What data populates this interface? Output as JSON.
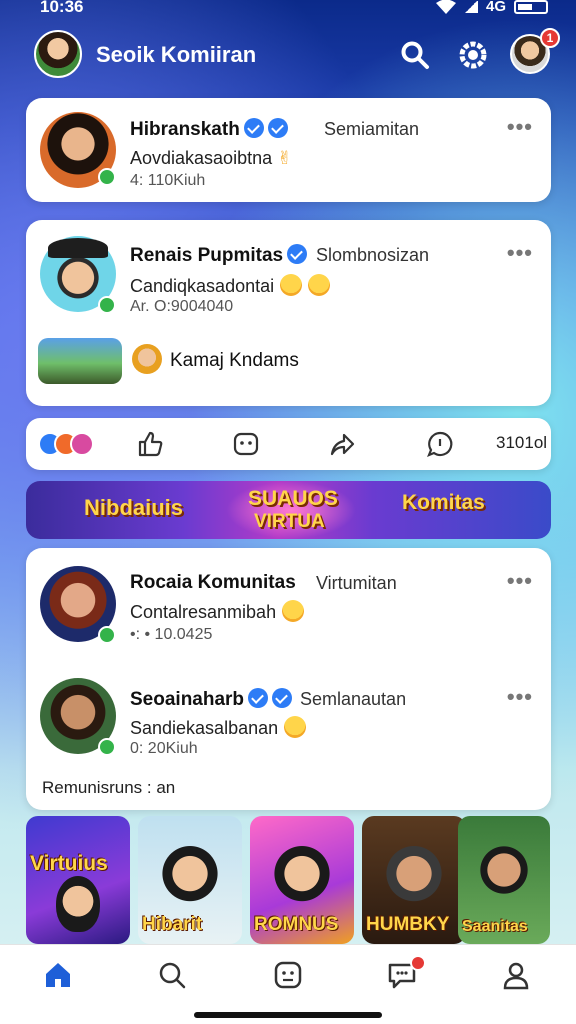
{
  "status_bar": {
    "time": "10:36",
    "network": "4G"
  },
  "header": {
    "title": "Seoik Komiiran",
    "notification_count": "1"
  },
  "posts": [
    {
      "name": "Hibranskath",
      "sub": "Semiamitan",
      "text": "Aovdiakasaoibtna",
      "meta": "4: 110Kiuh"
    },
    {
      "name": "Renais Pupmitas",
      "sub": "Slombnosizan",
      "text": "Candiqkasadontai",
      "meta": "Ar. O:9004040"
    },
    {
      "name": "Rocaia Komunitas",
      "sub": "Virtumitan",
      "text": "Contalresanmibah",
      "meta": "•: • 10.0425"
    },
    {
      "name": "Seoainaharb",
      "sub": "Semlanautan",
      "text": "Sandiekasalbanan",
      "meta": "0: 20Kiuh"
    }
  ],
  "shared_item": {
    "label": "Kamaj Kndams"
  },
  "action_bar": {
    "comment_count": "3101ol"
  },
  "banner": {
    "left": "Nibdaiuis",
    "center_top": "SUAUOS",
    "center_bottom": "VIRTUA",
    "right": "Komitas"
  },
  "community_footer": "Remunisruns : an",
  "thumbnails": [
    "Virtuius",
    "Hibarit",
    "ROMNUS",
    "HUMBKY",
    "Saanitas"
  ],
  "colors": {
    "brand": "#1e3fb0",
    "accent": "#2d7cf6",
    "online": "#34b34a",
    "badge": "#e53935"
  }
}
